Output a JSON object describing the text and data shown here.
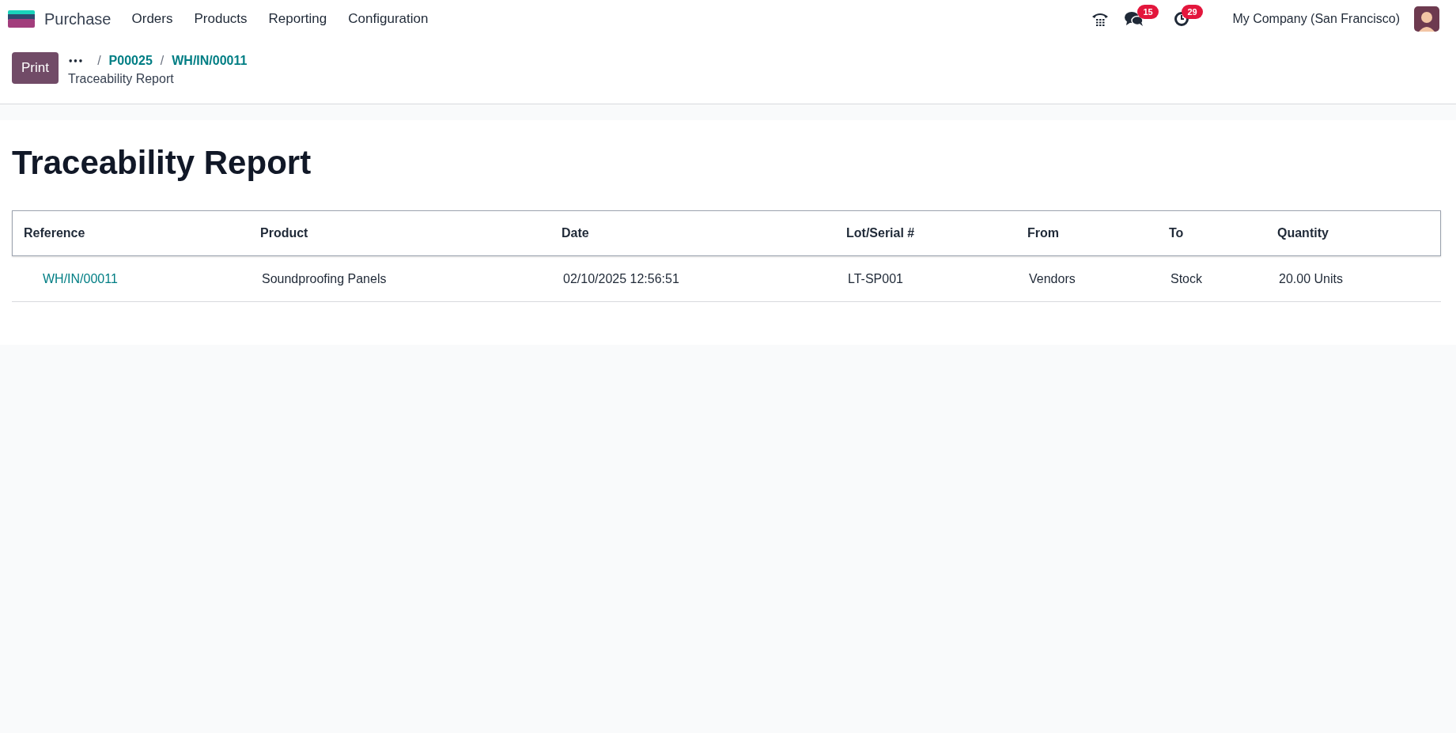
{
  "navbar": {
    "app_name": "Purchase",
    "menu": [
      "Orders",
      "Products",
      "Reporting",
      "Configuration"
    ],
    "messages_count": "15",
    "activities_count": "29",
    "company": "My Company (San Francisco)"
  },
  "control_panel": {
    "print_button": "Print",
    "breadcrumbs_more": "•••",
    "breadcrumb_separator": "/",
    "breadcrumbs": [
      "P00025",
      "WH/IN/00011"
    ],
    "current": "Traceability Report"
  },
  "report": {
    "title": "Traceability Report",
    "columns": [
      "Reference",
      "Product",
      "Date",
      "Lot/Serial #",
      "From",
      "To",
      "Quantity"
    ],
    "rows": [
      {
        "reference": "WH/IN/00011",
        "product": "Soundproofing Panels",
        "date": "02/10/2025 12:56:51",
        "lot": "LT-SP001",
        "from": "Vendors",
        "to": "Stock",
        "quantity": "20.00 Units"
      }
    ]
  }
}
